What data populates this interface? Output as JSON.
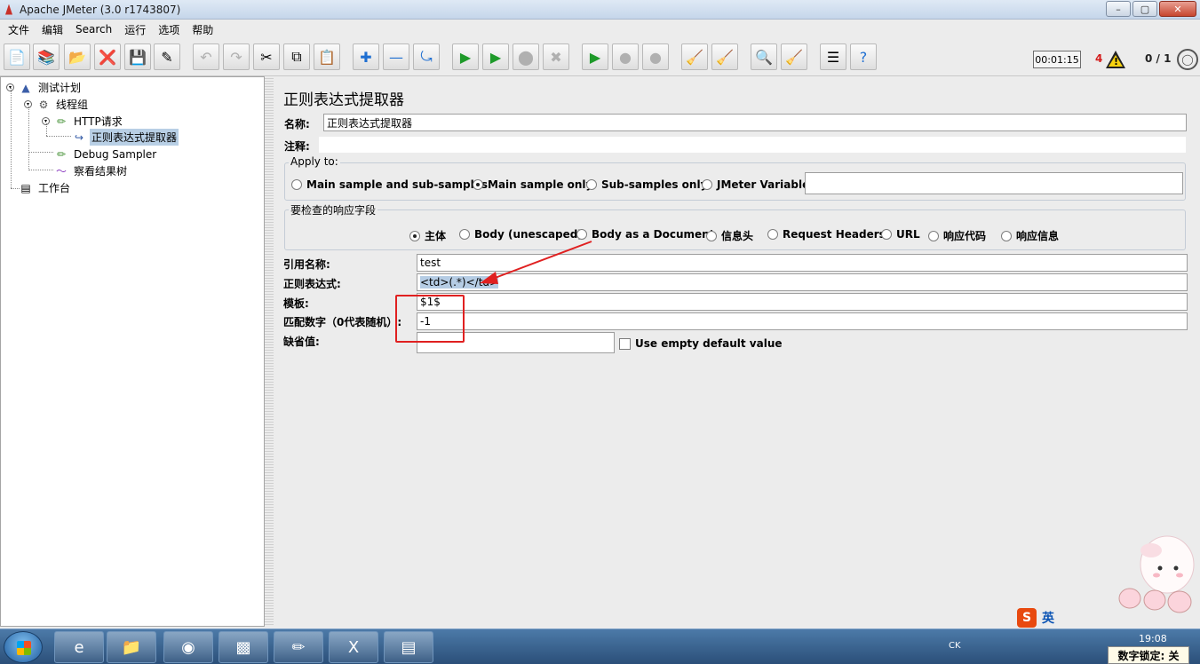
{
  "window": {
    "title": "Apache JMeter (3.0 r1743807)"
  },
  "menu": [
    "文件",
    "编辑",
    "Search",
    "运行",
    "选项",
    "帮助"
  ],
  "status": {
    "timer": "00:01:15",
    "error_count": "4",
    "threads": "0 / 1"
  },
  "tree": {
    "items": [
      {
        "label": "测试计划",
        "icon": "test-plan-icon"
      },
      {
        "label": "线程组",
        "icon": "gear-icon"
      },
      {
        "label": "HTTP请求",
        "icon": "pipette-icon"
      },
      {
        "label": "正则表达式提取器",
        "icon": "extractor-icon",
        "selected": true
      },
      {
        "label": "Debug Sampler",
        "icon": "pipette-icon"
      },
      {
        "label": "察看结果树",
        "icon": "graph-icon"
      },
      {
        "label": "工作台",
        "icon": "workbench-icon"
      }
    ]
  },
  "panel": {
    "title": "正则表达式提取器",
    "name_label": "名称:",
    "name_value": "正则表达式提取器",
    "comment_label": "注释:",
    "apply_to": {
      "title": "Apply to:",
      "options": [
        "Main sample and sub-samples",
        "Main sample only",
        "Sub-samples only",
        "JMeter Variable"
      ],
      "selected": "Main sample only"
    },
    "field_to_check": {
      "title": "要检查的响应字段",
      "options": [
        "主体",
        "Body (unescaped)",
        "Body as a Document",
        "信息头",
        "Request Headers",
        "URL",
        "响应代码",
        "响应信息"
      ],
      "selected": "主体"
    },
    "ref_name_label": "引用名称:",
    "ref_name_value": "test",
    "regex_label": "正则表达式:",
    "regex_value": "<td>(.*)</td>",
    "template_label": "模板:",
    "template_value": "$1$",
    "match_no_label": "匹配数字（0代表随机）:",
    "match_no_value": "-1",
    "default_label": "缺省值:",
    "default_value": "",
    "use_empty_label": "Use empty default value"
  },
  "ime": {
    "lang": "英"
  },
  "taskbar": {
    "tray_text": "CK",
    "clock": "19:08",
    "numlock": "数字锁定: 关"
  }
}
